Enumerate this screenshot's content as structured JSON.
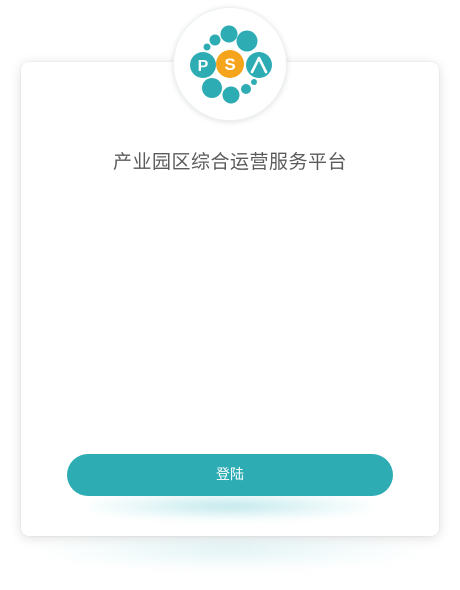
{
  "logo": {
    "letters": [
      "P",
      "S",
      "A"
    ],
    "colors": {
      "teal": "#2eacb4",
      "orange": "#f5a41b"
    }
  },
  "title": "产业园区综合运营服务平台",
  "login_button": {
    "label": "登陆",
    "color": "#2eacb4"
  }
}
